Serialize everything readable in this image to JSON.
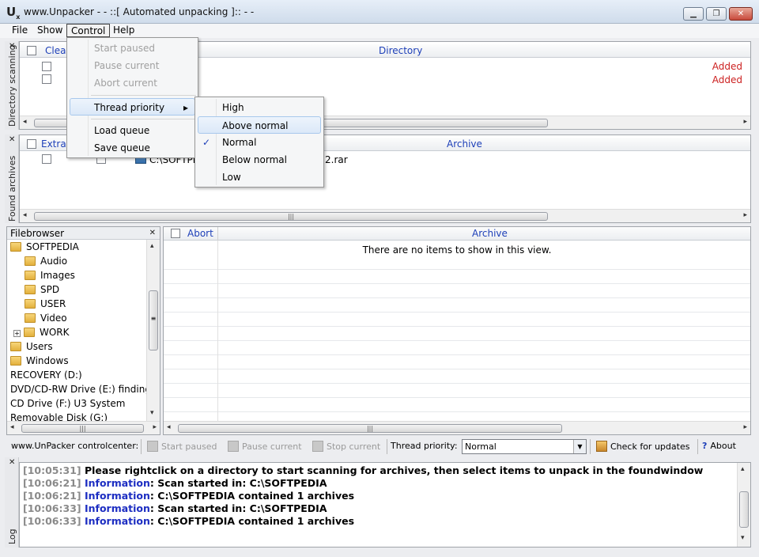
{
  "window": {
    "title": "www.Unpacker - - ::[ Automated unpacking ]:: - -",
    "icon_label": "U",
    "icon_sub": "x",
    "minimize": "▁",
    "maximize": "❐",
    "close": "✕"
  },
  "menubar": [
    "File",
    "Show",
    "Control",
    "Help"
  ],
  "control_menu": {
    "items": [
      "Start paused",
      "Pause current",
      "Abort current",
      "Thread priority",
      "Load queue",
      "Save queue"
    ],
    "submenu_arrow": "▸"
  },
  "priority_menu": {
    "items": [
      "High",
      "Above normal",
      "Normal",
      "Below normal",
      "Low"
    ],
    "checked": "Normal",
    "highlighted": "Above normal",
    "check_glyph": "✓"
  },
  "directory_panel": {
    "side_label": "Directory scanning",
    "columns": [
      "Clear",
      "Directory"
    ],
    "rows": [
      {
        "status": "Added"
      },
      {
        "status": "Added"
      }
    ]
  },
  "archives_panel": {
    "side_label": "Found archives",
    "columns": [
      "Extract",
      "Archive"
    ],
    "rows": [
      {
        "path": "C:\\SOFTPEDI",
        "archive_tail": "2.rar"
      }
    ]
  },
  "filebrowser": {
    "title": "Filebrowser",
    "items": [
      {
        "label": "SOFTPEDIA",
        "indent": 0,
        "folder": true
      },
      {
        "label": "Audio",
        "indent": 1,
        "folder": true
      },
      {
        "label": "Images",
        "indent": 1,
        "folder": true
      },
      {
        "label": "SPD",
        "indent": 1,
        "folder": true
      },
      {
        "label": "USER",
        "indent": 1,
        "folder": true
      },
      {
        "label": "Video",
        "indent": 1,
        "folder": true
      },
      {
        "label": "WORK",
        "indent": 1,
        "folder": true,
        "expander": "+"
      },
      {
        "label": "Users",
        "indent": 0,
        "folder": true
      },
      {
        "label": "Windows",
        "indent": 0,
        "folder": true
      },
      {
        "label": "RECOVERY (D:)",
        "indent": 0,
        "folder": false
      },
      {
        "label": "DVD/CD-RW Drive (E:) finding n",
        "indent": 0,
        "folder": false
      },
      {
        "label": "CD Drive (F:) U3 System",
        "indent": 0,
        "folder": false
      },
      {
        "label": "Removable Disk (G:)",
        "indent": 0,
        "folder": false
      }
    ]
  },
  "queue_panel": {
    "columns": [
      "Abort",
      "Archive"
    ],
    "empty_text": "There are no items to show in this view."
  },
  "controlbar": {
    "label": "www.UnPacker controlcenter:",
    "start_paused": "Start paused",
    "pause_current": "Pause current",
    "stop_current": "Stop current",
    "priority_label": "Thread priority:",
    "priority_value": "Normal",
    "check_updates": "Check for updates",
    "about": "About"
  },
  "log": {
    "side_label": "Log",
    "lines": [
      {
        "ts": "[10:05:31]",
        "kind": "",
        "text": "Please rightclick on a directory to start scanning for archives, then select items to unpack in the foundwindow"
      },
      {
        "ts": "[10:06:21]",
        "kind": "Information",
        "text": ": Scan started in: C:\\SOFTPEDIA"
      },
      {
        "ts": "[10:06:21]",
        "kind": "Information",
        "text": ": C:\\SOFTPEDIA contained 1 archives"
      },
      {
        "ts": "[10:06:33]",
        "kind": "Information",
        "text": ": Scan started in: C:\\SOFTPEDIA"
      },
      {
        "ts": "[10:06:33]",
        "kind": "Information",
        "text": ": C:\\SOFTPEDIA contained 1 archives"
      }
    ]
  },
  "colors": {
    "added": "#cc1f1f",
    "info": "#1d2ec2",
    "timestamp": "#8a8a8a",
    "header_link": "#1d3fb8"
  }
}
